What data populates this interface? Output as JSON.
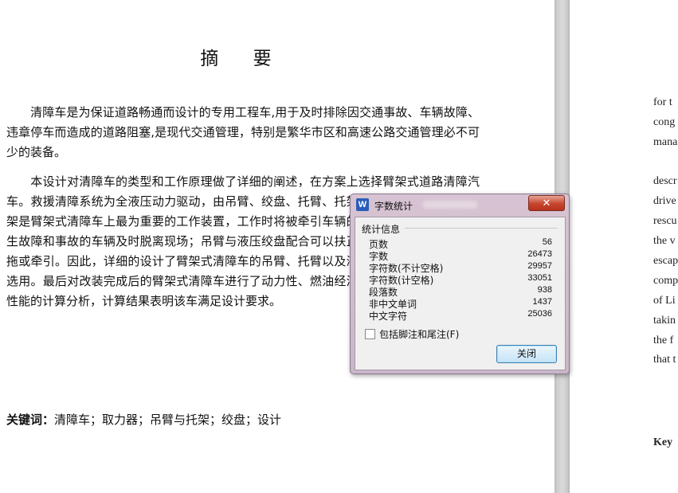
{
  "document": {
    "title": "摘 要",
    "paragraphs": [
      "清障车是为保证道路畅通而设计的专用工程车,用于及时排除因交通事故、车辆故障、违章停车而造成的道路阻塞,是现代交通管理，特别是繁华市区和高速公路交通管理必不可少的装备。",
      "本设计对清障车的类型和工作原理做了详细的阐述，在方案上选择臂架式道路清障汽车。救援清障系统为全液压动力驱动，由吊臂、绞盘、托臂、托架等部件组成。吊臂和托架是臂架式清障车上最为重要的工作装置，工作时将被牵引车辆的前桥或后桥托起，使发生故障和事故的车辆及时脱离现场；吊臂与液压绞盘配合可以扶正侧翻车辆，使其便于托拖或牵引。因此，详细的设计了臂架式清障车的吊臂、托臂以及液压系统，以及取力器的选用。最后对改装完成后的臂架式清障车进行了动力性、燃油经济性和稳定性等主要整车性能的计算分析，计算结果表明该车满足设计要求。"
    ],
    "keywords_label": "关键词：",
    "keywords": "清障车；取力器；吊臂与托架；绞盘；设计"
  },
  "english_fragments": [
    "for t",
    "cong",
    "mana",
    "descr",
    "drive",
    "rescu",
    "the v",
    "escap",
    "comp",
    "of Li",
    "takin",
    "the f",
    "that t",
    "Key"
  ],
  "dialog": {
    "title": "字数统计",
    "app_icon": "W",
    "close_glyph": "✕",
    "group_title": "统计信息",
    "stats": [
      {
        "label": "页数",
        "value": "56"
      },
      {
        "label": "字数",
        "value": "26473"
      },
      {
        "label": "字符数(不计空格)",
        "value": "29957"
      },
      {
        "label": "字符数(计空格)",
        "value": "33051"
      },
      {
        "label": "段落数",
        "value": "938"
      },
      {
        "label": "非中文单词",
        "value": "1437"
      },
      {
        "label": "中文字符",
        "value": "25036"
      }
    ],
    "checkbox_label": "包括脚注和尾注(F)",
    "checkbox_checked": false,
    "close_button": "关闭"
  },
  "colors": {
    "dialog_frame": "#c9b6c8",
    "close_button_red": "#c6452d",
    "accent_button": "#3c7fb1"
  }
}
